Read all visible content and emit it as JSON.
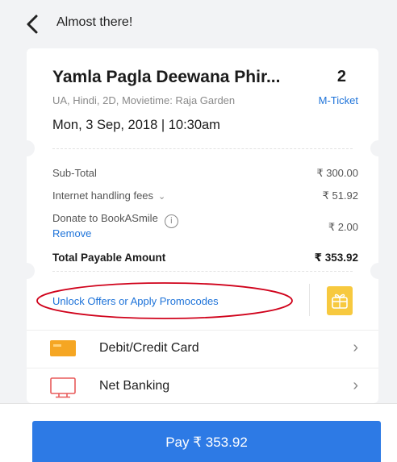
{
  "header": {
    "title": "Almost there!"
  },
  "booking": {
    "movie_title": "Yamla Pagla Deewana Phir...",
    "ticket_count": "2",
    "meta": "UA, Hindi, 2D, Movietime: Raja Garden",
    "ticket_type": "M-Ticket",
    "showtime": "Mon, 3 Sep, 2018 | 10:30am"
  },
  "summary": {
    "subtotal_label": "Sub-Total",
    "subtotal_value": "₹ 300.00",
    "fees_label": "Internet handling fees",
    "fees_value": "₹ 51.92",
    "donate_label": "Donate to BookASmile",
    "donate_value": "₹ 2.00",
    "remove_label": "Remove",
    "total_label": "Total Payable Amount",
    "total_value": "₹ 353.92"
  },
  "offers": {
    "label": "Unlock Offers or Apply Promocodes"
  },
  "payment_options": [
    {
      "label": "Debit/Credit Card",
      "icon": "credit-card-icon"
    },
    {
      "label": "Net Banking",
      "icon": "monitor-icon"
    }
  ],
  "pay_button": {
    "label": "Pay ₹ 353.92"
  },
  "colors": {
    "accent": "#2d7ae5",
    "link": "#1e73d9",
    "gift_tile": "#f7c93f",
    "highlight": "#d0021b"
  }
}
